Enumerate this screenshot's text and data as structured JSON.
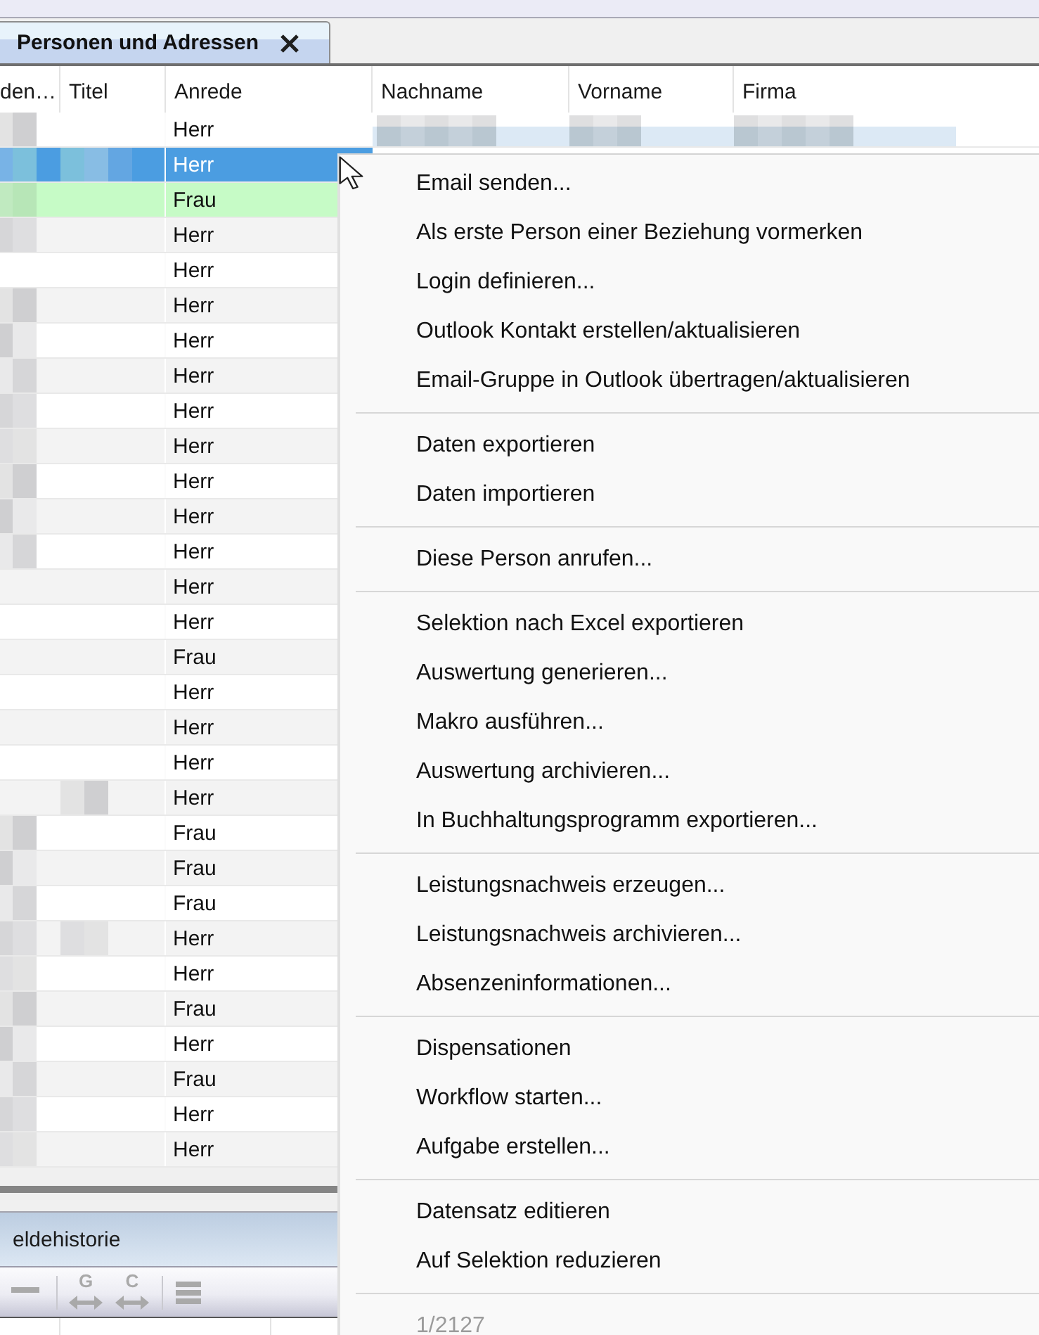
{
  "tabs": [
    {
      "label": "Personen und Adressen",
      "selected": true
    }
  ],
  "table": {
    "columns": [
      "den…",
      "Titel",
      "Anrede",
      "Nachname",
      "Vorname",
      "Firma"
    ],
    "rows": [
      {
        "selected": false,
        "highlighted": false,
        "cells": [
          {
            "kind": "blurred"
          },
          null,
          {
            "kind": "text",
            "text": "Herr"
          },
          {
            "kind": "blurred"
          },
          {
            "kind": "blurred"
          },
          {
            "kind": "blurred"
          }
        ]
      },
      {
        "selected": true,
        "highlighted": false,
        "cells": [
          {
            "kind": "blurred"
          },
          {
            "kind": "blurred"
          },
          {
            "kind": "text",
            "text": "Herr"
          }
        ]
      },
      {
        "selected": false,
        "highlighted": true,
        "cells": [
          {
            "kind": "blurred"
          },
          null,
          {
            "kind": "text",
            "text": "Frau"
          }
        ]
      },
      {
        "selected": false,
        "highlighted": false,
        "cells": [
          {
            "kind": "blurred"
          },
          null,
          {
            "kind": "text",
            "text": "Herr"
          }
        ]
      },
      {
        "selected": false,
        "highlighted": false,
        "cells": [
          null,
          null,
          {
            "kind": "text",
            "text": "Herr"
          }
        ]
      },
      {
        "selected": false,
        "highlighted": false,
        "cells": [
          {
            "kind": "blurred"
          },
          null,
          {
            "kind": "text",
            "text": "Herr"
          }
        ]
      },
      {
        "selected": false,
        "highlighted": false,
        "cells": [
          {
            "kind": "blurred"
          },
          null,
          {
            "kind": "text",
            "text": "Herr"
          }
        ]
      },
      {
        "selected": false,
        "highlighted": false,
        "cells": [
          {
            "kind": "blurred"
          },
          null,
          {
            "kind": "text",
            "text": "Herr"
          }
        ]
      },
      {
        "selected": false,
        "highlighted": false,
        "cells": [
          {
            "kind": "blurred"
          },
          null,
          {
            "kind": "text",
            "text": "Herr"
          }
        ]
      },
      {
        "selected": false,
        "highlighted": false,
        "cells": [
          {
            "kind": "blurred"
          },
          null,
          {
            "kind": "text",
            "text": "Herr"
          }
        ]
      },
      {
        "selected": false,
        "highlighted": false,
        "cells": [
          {
            "kind": "blurred"
          },
          null,
          {
            "kind": "text",
            "text": "Herr"
          }
        ]
      },
      {
        "selected": false,
        "highlighted": false,
        "cells": [
          {
            "kind": "blurred"
          },
          null,
          {
            "kind": "text",
            "text": "Herr"
          }
        ]
      },
      {
        "selected": false,
        "highlighted": false,
        "cells": [
          {
            "kind": "blurred"
          },
          null,
          {
            "kind": "text",
            "text": "Herr"
          }
        ]
      },
      {
        "selected": false,
        "highlighted": false,
        "cells": [
          null,
          null,
          {
            "kind": "text",
            "text": "Herr"
          }
        ]
      },
      {
        "selected": false,
        "highlighted": false,
        "cells": [
          null,
          null,
          {
            "kind": "text",
            "text": "Herr"
          }
        ]
      },
      {
        "selected": false,
        "highlighted": false,
        "cells": [
          null,
          null,
          {
            "kind": "text",
            "text": "Frau"
          }
        ]
      },
      {
        "selected": false,
        "highlighted": false,
        "cells": [
          null,
          null,
          {
            "kind": "text",
            "text": "Herr"
          }
        ]
      },
      {
        "selected": false,
        "highlighted": false,
        "cells": [
          null,
          null,
          {
            "kind": "text",
            "text": "Herr"
          }
        ]
      },
      {
        "selected": false,
        "highlighted": false,
        "cells": [
          null,
          null,
          {
            "kind": "text",
            "text": "Herr"
          }
        ]
      },
      {
        "selected": false,
        "highlighted": false,
        "cells": [
          null,
          {
            "kind": "blurred"
          },
          {
            "kind": "text",
            "text": "Herr"
          }
        ]
      },
      {
        "selected": false,
        "highlighted": false,
        "cells": [
          {
            "kind": "blurred"
          },
          null,
          {
            "kind": "text",
            "text": "Frau"
          }
        ]
      },
      {
        "selected": false,
        "highlighted": false,
        "cells": [
          {
            "kind": "blurred"
          },
          null,
          {
            "kind": "text",
            "text": "Frau"
          }
        ]
      },
      {
        "selected": false,
        "highlighted": false,
        "cells": [
          {
            "kind": "blurred"
          },
          null,
          {
            "kind": "text",
            "text": "Frau"
          }
        ]
      },
      {
        "selected": false,
        "highlighted": false,
        "cells": [
          {
            "kind": "blurred"
          },
          {
            "kind": "blurred"
          },
          {
            "kind": "text",
            "text": "Herr"
          }
        ]
      },
      {
        "selected": false,
        "highlighted": false,
        "cells": [
          {
            "kind": "blurred"
          },
          null,
          {
            "kind": "text",
            "text": "Herr"
          }
        ]
      },
      {
        "selected": false,
        "highlighted": false,
        "cells": [
          {
            "kind": "blurred"
          },
          null,
          {
            "kind": "text",
            "text": "Frau"
          }
        ]
      },
      {
        "selected": false,
        "highlighted": false,
        "cells": [
          {
            "kind": "blurred"
          },
          null,
          {
            "kind": "text",
            "text": "Herr"
          }
        ]
      },
      {
        "selected": false,
        "highlighted": false,
        "cells": [
          {
            "kind": "blurred"
          },
          null,
          {
            "kind": "text",
            "text": "Frau"
          }
        ]
      },
      {
        "selected": false,
        "highlighted": false,
        "cells": [
          {
            "kind": "blurred"
          },
          null,
          {
            "kind": "text",
            "text": "Herr"
          }
        ]
      },
      {
        "selected": false,
        "highlighted": false,
        "cells": [
          {
            "kind": "blurred"
          },
          null,
          {
            "kind": "text",
            "text": "Herr"
          }
        ]
      }
    ]
  },
  "panel": {
    "title": "eldehistorie",
    "toolbar": [
      {
        "kind": "minus",
        "disabled": true
      },
      {
        "kind": "separator"
      },
      {
        "kind": "letter_arrows",
        "label": "G",
        "disabled": true
      },
      {
        "kind": "letter_arrows",
        "label": "C",
        "disabled": true
      },
      {
        "kind": "separator"
      },
      {
        "kind": "lines",
        "disabled": true
      }
    ]
  },
  "context_menu": {
    "items": [
      {
        "kind": "item",
        "label": "Email senden...",
        "disabled": false
      },
      {
        "kind": "item",
        "label": "Als erste Person einer Beziehung vormerken",
        "disabled": false
      },
      {
        "kind": "item",
        "label": "Login definieren...",
        "disabled": false
      },
      {
        "kind": "item",
        "label": "Outlook Kontakt erstellen/aktualisieren",
        "disabled": false
      },
      {
        "kind": "item",
        "label": "Email-Gruppe in Outlook übertragen/aktualisieren",
        "disabled": false
      },
      {
        "kind": "separator"
      },
      {
        "kind": "item",
        "label": "Daten exportieren",
        "disabled": false
      },
      {
        "kind": "item",
        "label": "Daten importieren",
        "disabled": false
      },
      {
        "kind": "separator"
      },
      {
        "kind": "item",
        "label": "Diese Person anrufen...",
        "disabled": false
      },
      {
        "kind": "separator"
      },
      {
        "kind": "item",
        "label": "Selektion nach Excel exportieren",
        "disabled": false
      },
      {
        "kind": "item",
        "label": "Auswertung generieren...",
        "disabled": false
      },
      {
        "kind": "item",
        "label": "Makro ausführen...",
        "disabled": false
      },
      {
        "kind": "item",
        "label": "Auswertung archivieren...",
        "disabled": false
      },
      {
        "kind": "item",
        "label": "In Buchhaltungsprogramm exportieren...",
        "disabled": false
      },
      {
        "kind": "separator"
      },
      {
        "kind": "item",
        "label": "Leistungsnachweis erzeugen...",
        "disabled": false
      },
      {
        "kind": "item",
        "label": "Leistungsnachweis archivieren...",
        "disabled": false
      },
      {
        "kind": "item",
        "label": "Absenzeninformationen...",
        "disabled": false
      },
      {
        "kind": "separator"
      },
      {
        "kind": "item",
        "label": "Dispensationen",
        "disabled": false
      },
      {
        "kind": "item",
        "label": "Workflow starten...",
        "disabled": false
      },
      {
        "kind": "item",
        "label": "Aufgabe erstellen...",
        "disabled": false
      },
      {
        "kind": "separator"
      },
      {
        "kind": "item",
        "label": "Datensatz editieren",
        "disabled": false
      },
      {
        "kind": "item",
        "label": "Auf Selektion reduzieren",
        "disabled": false
      },
      {
        "kind": "separator"
      },
      {
        "kind": "item",
        "label": "1/2127",
        "disabled": true
      }
    ]
  }
}
